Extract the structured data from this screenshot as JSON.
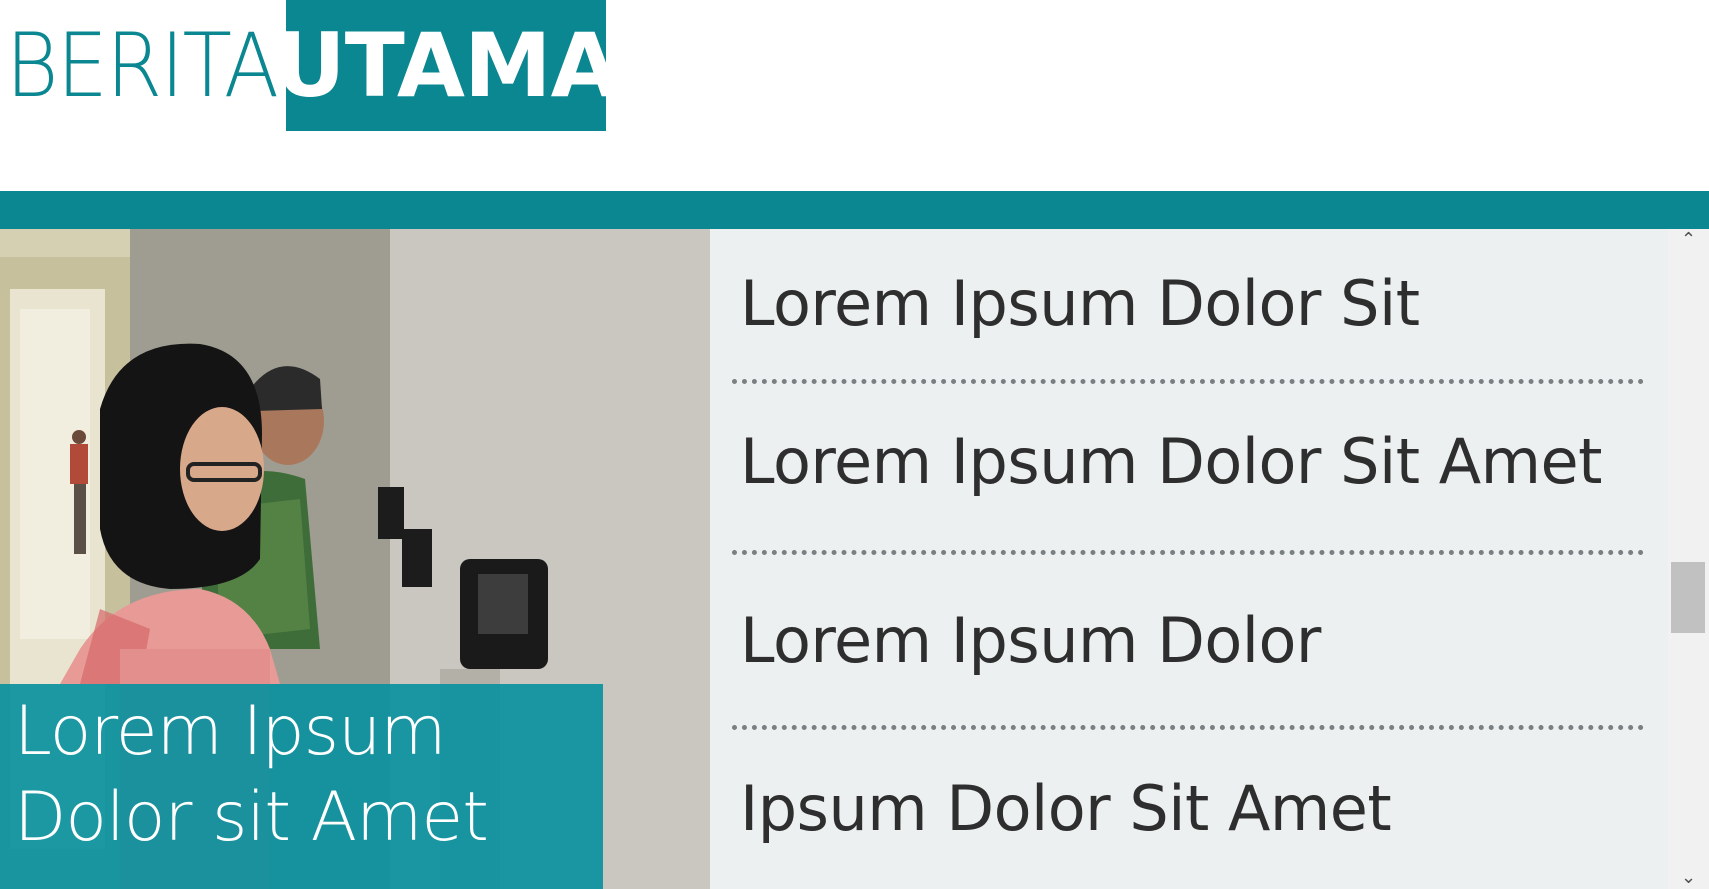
{
  "header": {
    "logo_word_1": "BERITA",
    "logo_word_2": "UTAMA",
    "brand_color": "#0a8790"
  },
  "featured": {
    "caption_line_1": "Lorem Ipsum",
    "caption_line_2": "Dolor sit Amet",
    "caption_bg": "#0a91a0"
  },
  "news_list": {
    "items": [
      {
        "title": "Lorem Ipsum Dolor Sit"
      },
      {
        "title": "Lorem Ipsum Dolor Sit Amet"
      },
      {
        "title": "Lorem Ipsum Dolor"
      },
      {
        "title": "Ipsum Dolor Sit Amet"
      }
    ],
    "background": "#ecf0f1"
  },
  "scrollbar": {
    "up_icon": "chevron-up-icon",
    "down_icon": "chevron-down-icon"
  }
}
